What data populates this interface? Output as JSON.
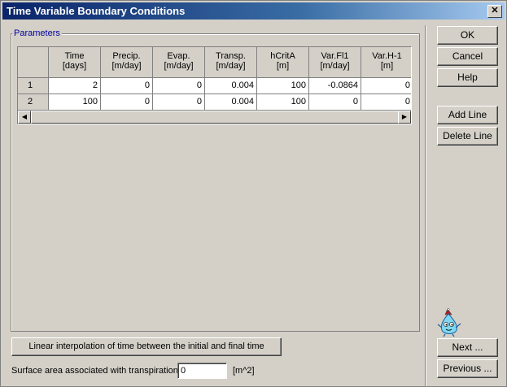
{
  "window": {
    "title": "Time Variable Boundary Conditions",
    "close_glyph": "✕"
  },
  "parameters": {
    "label": "Parameters",
    "columns": [
      {
        "name": "Time",
        "unit": "[days]"
      },
      {
        "name": "Precip.",
        "unit": "[m/day]"
      },
      {
        "name": "Evap.",
        "unit": "[m/day]"
      },
      {
        "name": "Transp.",
        "unit": "[m/day]"
      },
      {
        "name": "hCritA",
        "unit": "[m]"
      },
      {
        "name": "Var.Fl1",
        "unit": "[m/day]"
      },
      {
        "name": "Var.H-1",
        "unit": "[m]"
      }
    ],
    "rows": [
      {
        "index": "1",
        "values": [
          "2",
          "0",
          "0",
          "0.004",
          "100",
          "-0.0864",
          "0"
        ]
      },
      {
        "index": "2",
        "values": [
          "100",
          "0",
          "0",
          "0.004",
          "100",
          "0",
          "0"
        ]
      }
    ]
  },
  "buttons": {
    "ok": "OK",
    "cancel": "Cancel",
    "help": "Help",
    "add_line": "Add Line",
    "delete_line": "Delete Line",
    "next": "Next ...",
    "previous": "Previous ...",
    "interpolation": "Linear interpolation of time between the initial and final time"
  },
  "surface_area": {
    "label": "Surface area associated with transpiration:",
    "value": "0",
    "unit": "[m^2]"
  },
  "colors": {
    "titlebar_start": "#0a246a",
    "titlebar_end": "#a6caf0",
    "group_label": "#0000a0"
  }
}
